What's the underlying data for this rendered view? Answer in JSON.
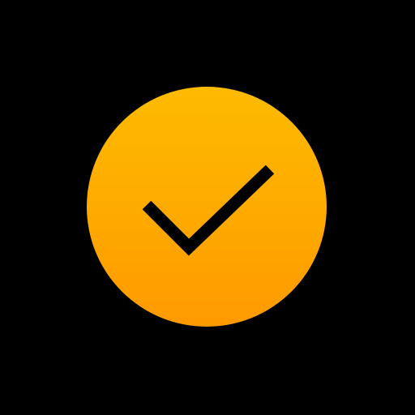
{
  "icon": {
    "name": "check-circle-icon",
    "colors": {
      "background": "#000000",
      "gradient_top": "#FDBB00",
      "gradient_bottom": "#FF9A00",
      "checkmark": "#000000"
    }
  }
}
